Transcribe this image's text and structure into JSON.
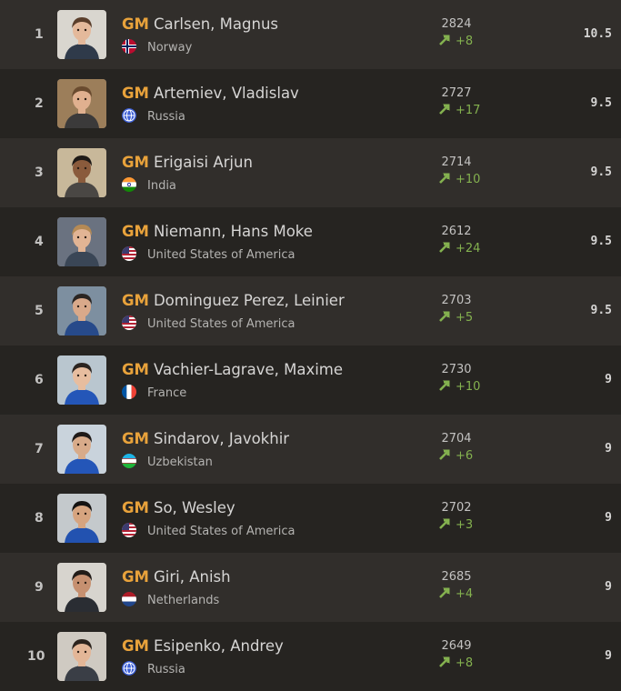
{
  "colors": {
    "row_odd": "#312e2b",
    "row_even": "#262421",
    "title": "#e8a23b",
    "rating_up": "#84b14f"
  },
  "players": [
    {
      "rank": "1",
      "title": "GM",
      "name": "Carlsen, Magnus",
      "country": "Norway",
      "flag": "norway-flag-icon",
      "rating": "2824",
      "change": "+8",
      "score": "10.5"
    },
    {
      "rank": "2",
      "title": "GM",
      "name": "Artemiev, Vladislav",
      "country": "Russia",
      "flag": "globe-icon",
      "rating": "2727",
      "change": "+17",
      "score": "9.5"
    },
    {
      "rank": "3",
      "title": "GM",
      "name": "Erigaisi Arjun",
      "country": "India",
      "flag": "india-flag-icon",
      "rating": "2714",
      "change": "+10",
      "score": "9.5"
    },
    {
      "rank": "4",
      "title": "GM",
      "name": "Niemann, Hans Moke",
      "country": "United States of America",
      "flag": "usa-flag-icon",
      "rating": "2612",
      "change": "+24",
      "score": "9.5"
    },
    {
      "rank": "5",
      "title": "GM",
      "name": "Dominguez Perez, Leinier",
      "country": "United States of America",
      "flag": "usa-flag-icon",
      "rating": "2703",
      "change": "+5",
      "score": "9.5"
    },
    {
      "rank": "6",
      "title": "GM",
      "name": "Vachier-Lagrave, Maxime",
      "country": "France",
      "flag": "france-flag-icon",
      "rating": "2730",
      "change": "+10",
      "score": "9"
    },
    {
      "rank": "7",
      "title": "GM",
      "name": "Sindarov, Javokhir",
      "country": "Uzbekistan",
      "flag": "uzbekistan-flag-icon",
      "rating": "2704",
      "change": "+6",
      "score": "9"
    },
    {
      "rank": "8",
      "title": "GM",
      "name": "So, Wesley",
      "country": "United States of America",
      "flag": "usa-flag-icon",
      "rating": "2702",
      "change": "+3",
      "score": "9"
    },
    {
      "rank": "9",
      "title": "GM",
      "name": "Giri, Anish",
      "country": "Netherlands",
      "flag": "netherlands-flag-icon",
      "rating": "2685",
      "change": "+4",
      "score": "9"
    },
    {
      "rank": "10",
      "title": "GM",
      "name": "Esipenko, Andrey",
      "country": "Russia",
      "flag": "globe-icon",
      "rating": "2649",
      "change": "+8",
      "score": "9"
    }
  ]
}
